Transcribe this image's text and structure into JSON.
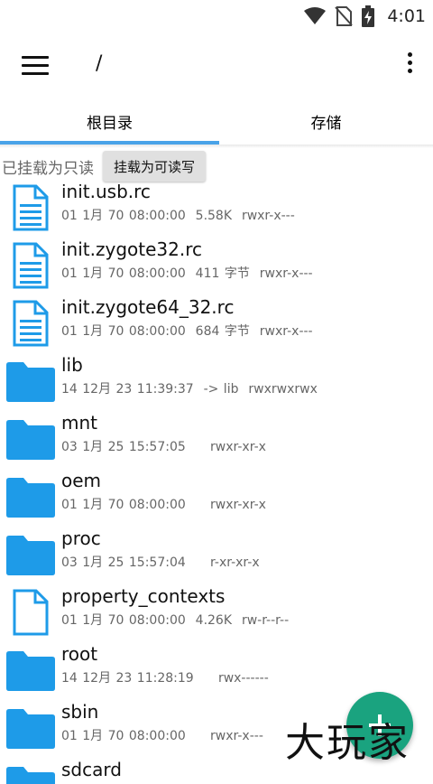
{
  "status_bar": {
    "time": "4:01",
    "icons": [
      "wifi-icon",
      "no-sim-icon",
      "battery-charging-icon"
    ]
  },
  "app_bar": {
    "path": "/",
    "menu_icon": "hamburger-menu-icon",
    "more_icon": "more-vert-icon"
  },
  "tabs": [
    {
      "label": "根目录",
      "selected": true
    },
    {
      "label": "存储",
      "selected": false
    }
  ],
  "mount": {
    "status": "已挂载为只读",
    "button": "挂载为可读写"
  },
  "files": [
    {
      "name": "init.usb.rc",
      "date": "01 1月 70 08:00:00",
      "size": "5.58K",
      "perms": "rwxr-x---",
      "kind": "text"
    },
    {
      "name": "init.zygote32.rc",
      "date": "01 1月 70 08:00:00",
      "size": "411 字节",
      "perms": "rwxr-x---",
      "kind": "text"
    },
    {
      "name": "init.zygote64_32.rc",
      "date": "01 1月 70 08:00:00",
      "size": "684 字节",
      "perms": "rwxr-x---",
      "kind": "text"
    },
    {
      "name": "lib",
      "date": "14 12月 23 11:39:37",
      "size": "-> lib",
      "perms": "rwxrwxrwx",
      "kind": "folder"
    },
    {
      "name": "mnt",
      "date": "03 1月 25 15:57:05",
      "size": "",
      "perms": "rwxr-xr-x",
      "kind": "folder"
    },
    {
      "name": "oem",
      "date": "01 1月 70 08:00:00",
      "size": "",
      "perms": "rwxr-xr-x",
      "kind": "folder"
    },
    {
      "name": "proc",
      "date": "03 1月 25 15:57:04",
      "size": "",
      "perms": "r-xr-xr-x",
      "kind": "folder"
    },
    {
      "name": "property_contexts",
      "date": "01 1月 70 08:00:00",
      "size": "4.26K",
      "perms": "rw-r--r--",
      "kind": "file"
    },
    {
      "name": "root",
      "date": "14 12月 23 11:28:19",
      "size": "",
      "perms": "rwx------",
      "kind": "folder"
    },
    {
      "name": "sbin",
      "date": "01 1月 70 08:00:00",
      "size": "",
      "perms": "rwxr-x---",
      "kind": "folder"
    },
    {
      "name": "sdcard",
      "date": "",
      "size": "",
      "perms": "",
      "kind": "folder"
    }
  ],
  "fab": {
    "icon": "add-icon"
  },
  "watermark": "大玩家",
  "colors": {
    "accent": "#4aa3e8",
    "folder": "#1e9be8",
    "fab": "#1aa37f"
  }
}
